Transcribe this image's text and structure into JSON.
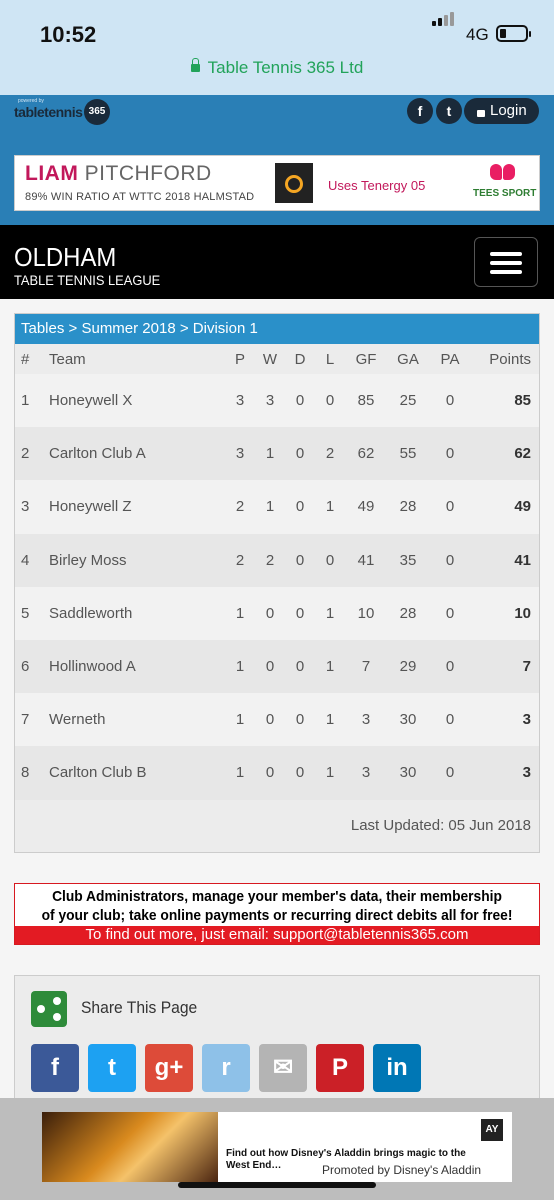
{
  "status": {
    "time": "10:52",
    "network": "4G"
  },
  "browser": {
    "url_title": "Table Tennis 365 Ltd"
  },
  "site": {
    "logo_small": "powered by",
    "logo_main": "tabletennis",
    "logo_badge": "365",
    "login_label": "Login",
    "social": [
      "f",
      "t"
    ]
  },
  "banner": {
    "first_name": "LIAM",
    "last_name": "PITCHFORD",
    "subtitle": "89% WIN RATIO AT WTTC 2018 HALMSTAD",
    "product": "Uses Tenergy 05",
    "sponsor": "TEES SPORT"
  },
  "league": {
    "title": "OLDHAM",
    "subtitle": "TABLE TENNIS LEAGUE"
  },
  "table": {
    "breadcrumb": [
      "Tables",
      "Summer 2018",
      "Division 1"
    ],
    "breadcrumb_sep": ">",
    "headers": [
      "#",
      "Team",
      "P",
      "W",
      "D",
      "L",
      "GF",
      "GA",
      "PA",
      "Points"
    ],
    "rows": [
      [
        "1",
        "Honeywell X",
        "3",
        "3",
        "0",
        "0",
        "85",
        "25",
        "0",
        "85"
      ],
      [
        "2",
        "Carlton Club A",
        "3",
        "1",
        "0",
        "2",
        "62",
        "55",
        "0",
        "62"
      ],
      [
        "3",
        "Honeywell Z",
        "2",
        "1",
        "0",
        "1",
        "49",
        "28",
        "0",
        "49"
      ],
      [
        "4",
        "Birley Moss",
        "2",
        "2",
        "0",
        "0",
        "41",
        "35",
        "0",
        "41"
      ],
      [
        "5",
        "Saddleworth",
        "1",
        "0",
        "0",
        "1",
        "10",
        "28",
        "0",
        "10"
      ],
      [
        "6",
        "Hollinwood A",
        "1",
        "0",
        "0",
        "1",
        "7",
        "29",
        "0",
        "7"
      ],
      [
        "7",
        "Werneth",
        "1",
        "0",
        "0",
        "1",
        "3",
        "30",
        "0",
        "3"
      ],
      [
        "8",
        "Carlton Club B",
        "1",
        "0",
        "0",
        "1",
        "3",
        "30",
        "0",
        "3"
      ]
    ],
    "updated": "Last Updated: 05 Jun 2018"
  },
  "club_ad": {
    "line1": "Club Administrators, manage your member's data, their membership",
    "line2": "of your club; take online payments or recurring direct debits all for free!",
    "line3": "To find out more, just email: support@tabletennis365.com"
  },
  "share": {
    "title": "Share This Page",
    "buttons": [
      {
        "name": "facebook",
        "glyph": "f",
        "color": "#3b5998"
      },
      {
        "name": "twitter",
        "glyph": "t",
        "color": "#1da1f2"
      },
      {
        "name": "google-plus",
        "glyph": "g+",
        "color": "#dd4b39"
      },
      {
        "name": "reddit",
        "glyph": "r",
        "color": "#8ec1e8"
      },
      {
        "name": "email",
        "glyph": "✉",
        "color": "#b4b4b4"
      },
      {
        "name": "pinterest",
        "glyph": "P",
        "color": "#cb2027"
      },
      {
        "name": "linkedin",
        "glyph": "in",
        "color": "#0077b5"
      }
    ]
  },
  "bottom_ad": {
    "text": "Find out how Disney's Aladdin brings magic to the West End…",
    "promoted": "Promoted by Disney's Aladdin",
    "badge": "AY"
  }
}
